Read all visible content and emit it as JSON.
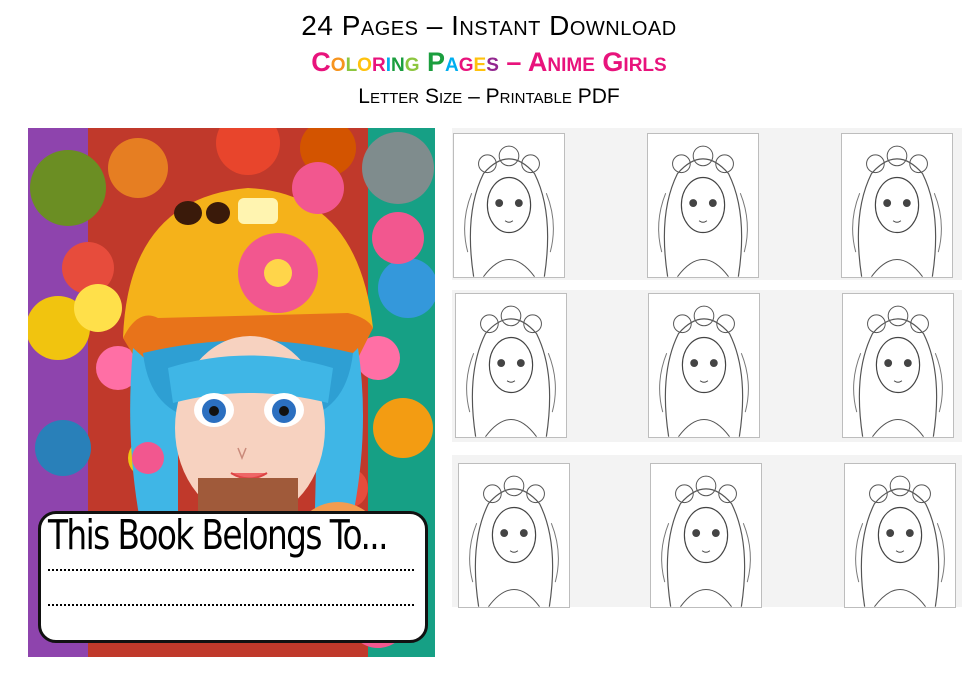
{
  "header": {
    "line1": "24 Pages – Instant Download",
    "line2_letters": [
      "C",
      "o",
      "l",
      "o",
      "r",
      "i",
      "n",
      "g",
      " ",
      "P",
      "a",
      "g",
      "e",
      "s"
    ],
    "line2_letter_colors": [
      "#e8137c",
      "#f7941d",
      "#8dc63f",
      "#ffc20e",
      "#e8137c",
      "#00aeef",
      "#1b9e3e",
      "#8dc63f",
      "#000000",
      "#1b9e3e",
      "#00aeef",
      "#e8137c",
      "#ffc20e",
      "#92278f"
    ],
    "line2_rest": " – Anime Girls",
    "line3": "Letter Size – Printable PDF"
  },
  "cover": {
    "belongs_text": "This Book Belongs To...",
    "hair_color": "#3fb6e6",
    "hat_color": "#f5b21a",
    "flower_color": "#f2578f"
  },
  "thumbnails": [
    {
      "name": "flower-crown-girl"
    },
    {
      "name": "flower-crown-wavy-hair-girl"
    },
    {
      "name": "headband-girl"
    },
    {
      "name": "knit-beanie-girl"
    },
    {
      "name": "flower-crown-curly-girl"
    },
    {
      "name": "curly-hair-portrait-girl"
    },
    {
      "name": "rose-crown-girl"
    },
    {
      "name": "bangs-flower-girl"
    },
    {
      "name": "rose-crown-long-hair-girl"
    }
  ]
}
